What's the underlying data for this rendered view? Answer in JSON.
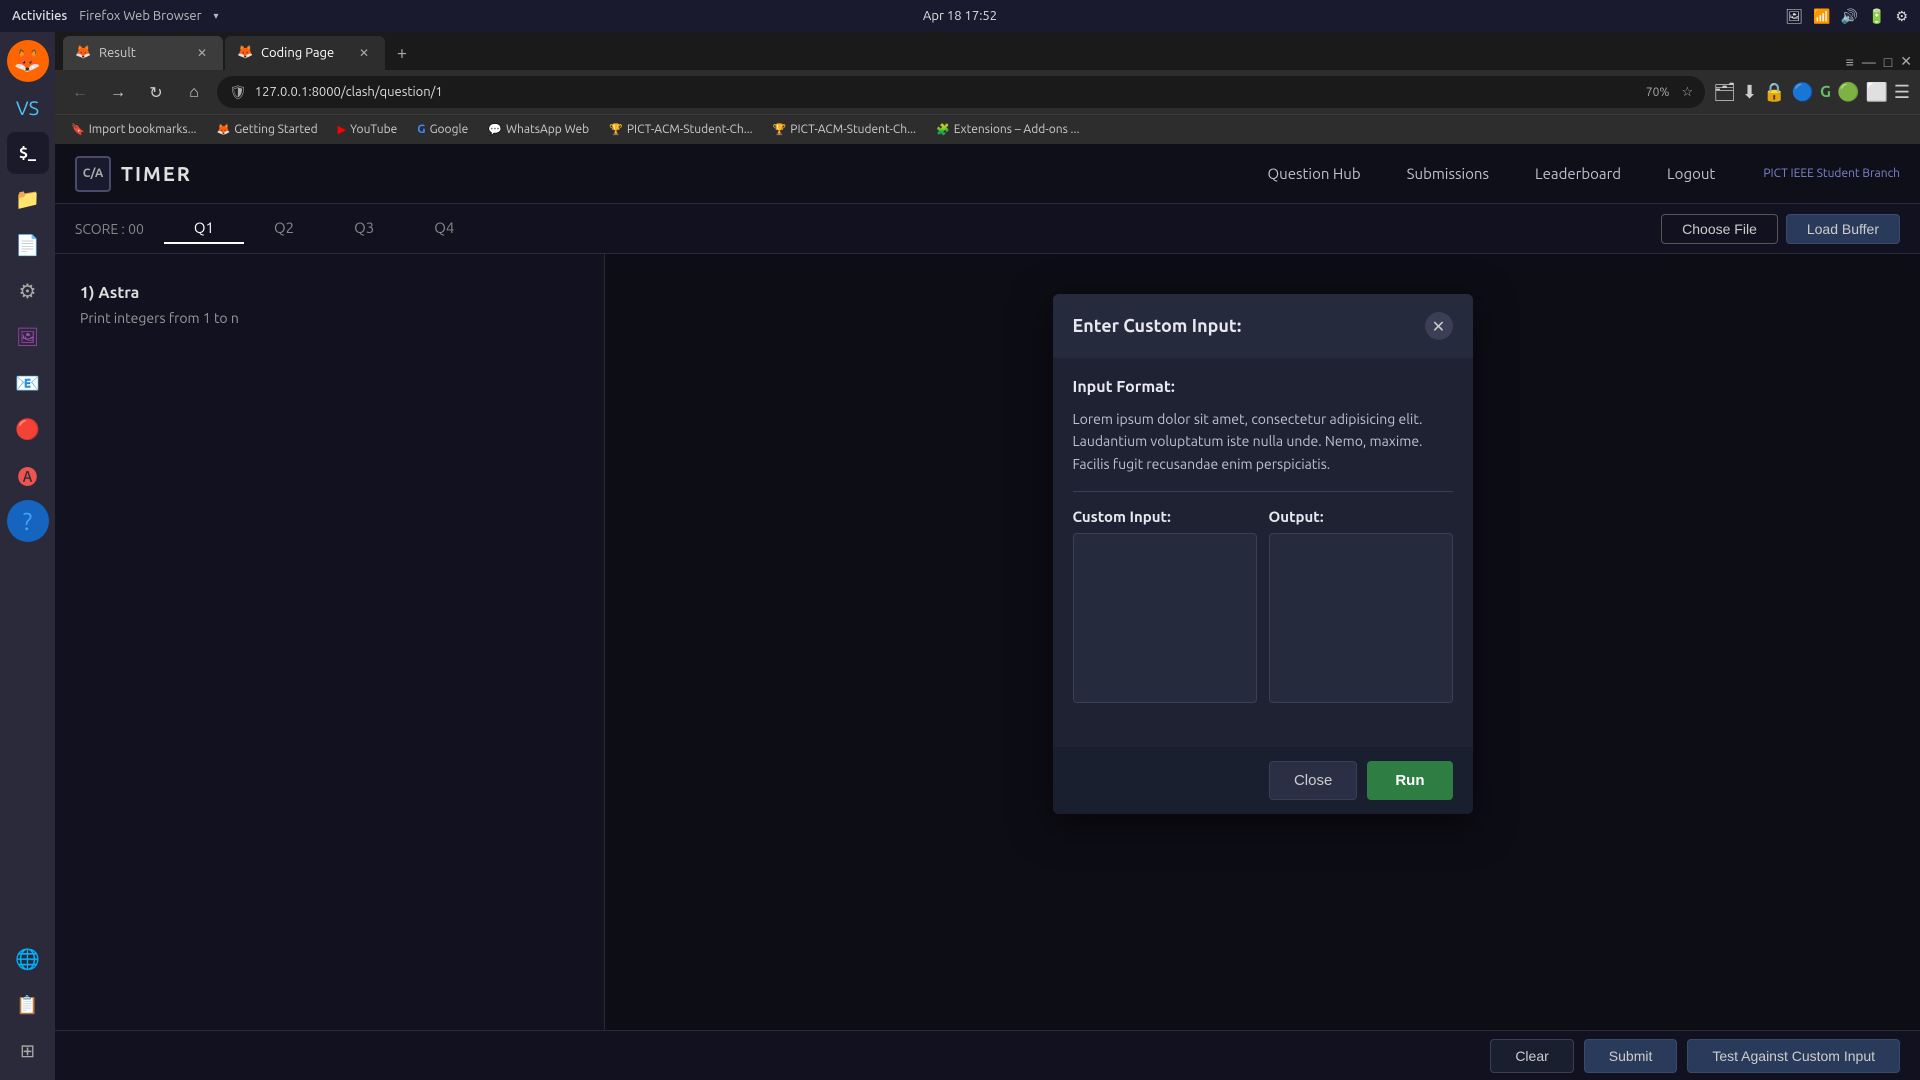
{
  "os": {
    "activities": "Activities",
    "browser_name": "Firefox Web Browser",
    "date_time": "Apr 18  17:52"
  },
  "browser": {
    "tabs": [
      {
        "id": "result",
        "label": "Result",
        "active": false
      },
      {
        "id": "coding",
        "label": "Coding Page",
        "active": true
      }
    ],
    "url": "127.0.0.1:8000/clash/question/1",
    "zoom": "70%",
    "bookmarks": [
      {
        "label": "Import bookmarks...",
        "icon": "🔖"
      },
      {
        "label": "Getting Started",
        "icon": "🦊"
      },
      {
        "label": "YouTube",
        "icon": "▶"
      },
      {
        "label": "Google",
        "icon": "G"
      },
      {
        "label": "WhatsApp Web",
        "icon": "💬"
      },
      {
        "label": "PICT-ACM-Student-Ch...",
        "icon": "🏆"
      },
      {
        "label": "PICT-ACM-Student-Ch...",
        "icon": "🏆"
      },
      {
        "label": "Extensions – Add-ons ...",
        "icon": "🧩"
      }
    ]
  },
  "app": {
    "logo_text": "C/A",
    "title": "TIMER",
    "nav_items": [
      "Question Hub",
      "Submissions",
      "Leaderboard",
      "Logout"
    ],
    "brand": "PICT IEEE Student Branch"
  },
  "score_bar": {
    "score_label": "SCORE : 00",
    "tabs": [
      "Q1",
      "Q2",
      "Q3",
      "Q4"
    ],
    "active_tab": "Q1"
  },
  "toolbar": {
    "choose_file": "Choose File",
    "load_buffer": "Load Buffer"
  },
  "question": {
    "title": "1) Astra",
    "description": "Print integers from 1 to n"
  },
  "modal": {
    "title": "Enter Custom Input:",
    "section_title": "Input Format:",
    "format_text": "Lorem ipsum dolor sit amet, consectetur adipisicing elit. Laudantium voluptatum iste nulla unde. Nemo, maxime. Facilis fugit recusandae enim perspiciatis.",
    "custom_input_label": "Custom Input:",
    "output_label": "Output:",
    "close_button": "Close",
    "run_button": "Run"
  },
  "bottom_bar": {
    "clear_label": "Clear",
    "submit_label": "Submit",
    "test_custom_label": "Test Against Custom Input"
  }
}
